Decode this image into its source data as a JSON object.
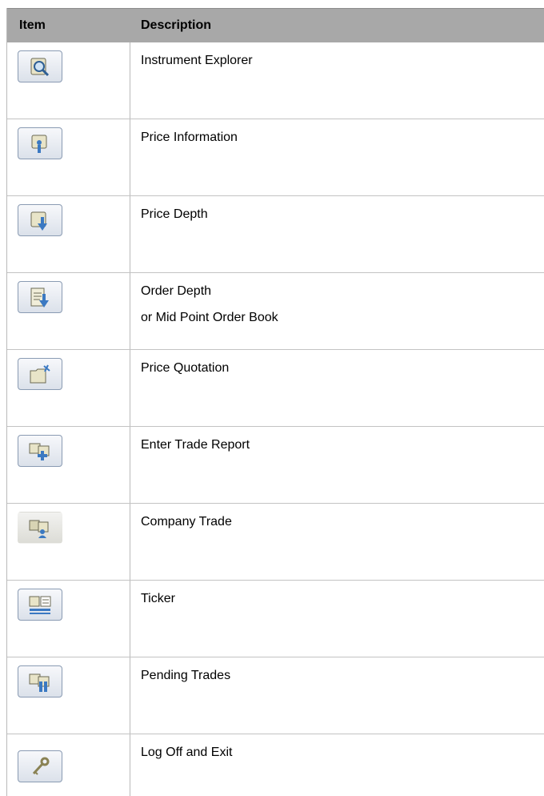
{
  "header": {
    "item": "Item",
    "description": "Description"
  },
  "rows": [
    {
      "icon": "instrument-explorer-icon",
      "description": "Instrument Explorer"
    },
    {
      "icon": "price-information-icon",
      "description": "Price Information"
    },
    {
      "icon": "price-depth-icon",
      "description": "Price Depth"
    },
    {
      "icon": "order-depth-icon",
      "description": "Order Depth",
      "description_line2": "or Mid Point Order Book"
    },
    {
      "icon": "price-quotation-icon",
      "description": "Price Quotation"
    },
    {
      "icon": "enter-trade-report-icon",
      "description": "Enter Trade Report"
    },
    {
      "icon": "company-trade-icon",
      "description": "Company Trade"
    },
    {
      "icon": "ticker-icon",
      "description": "Ticker"
    },
    {
      "icon": "pending-trades-icon",
      "description": "Pending Trades"
    },
    {
      "icon": "log-off-exit-icon",
      "description": "Log Off and Exit"
    }
  ]
}
